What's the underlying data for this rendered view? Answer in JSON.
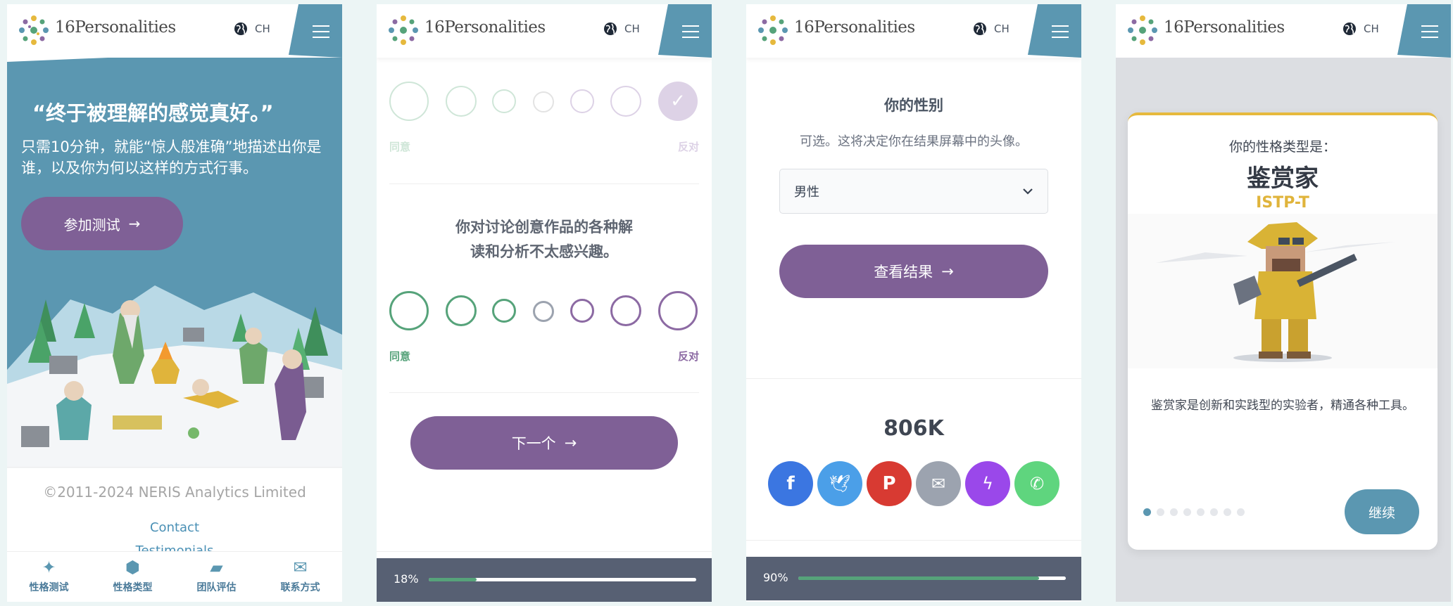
{
  "app": {
    "brand": "16Personalities",
    "lang": "CH"
  },
  "home": {
    "quote": "“终于被理解的感觉真好。”",
    "subtitle": "只需10分钟，就能“惊人般准确”地描述出你是谁，以及你为何以这样的方式行事。",
    "cta": "参加测试",
    "copyright": "©2011-2024 NERIS Analytics Limited",
    "links": [
      "Contact",
      "Testimonials"
    ],
    "nav": [
      "性格测试",
      "性格类型",
      "团队评估",
      "联系方式"
    ]
  },
  "test": {
    "agree": "同意",
    "disagree": "反对",
    "question": "你对讨论创意作品的各种解读和分析不太感兴趣。",
    "next": "下一个",
    "progress_label": "18%",
    "progress": 0.18
  },
  "gender": {
    "title": "你的性别",
    "hint": "可选。这将决定你在结果屏幕中的头像。",
    "selected": "男性",
    "submit": "查看结果",
    "count": "806K",
    "shares": [
      "facebook",
      "twitter",
      "pinterest",
      "email",
      "messenger",
      "whatsapp"
    ],
    "share_colors": [
      "#3b76e1",
      "#4b9fe8",
      "#d83a32",
      "#9ca3af",
      "#9a48ea",
      "#5fd57e"
    ],
    "progress_label": "90%",
    "progress": 0.9
  },
  "result": {
    "label": "你的性格类型是：",
    "type": "鉴赏家",
    "code": "ISTP-T",
    "desc": "鉴赏家是创新和实践型的实验者，精通各种工具。",
    "continue": "继续",
    "pages": 8,
    "current": 1
  }
}
